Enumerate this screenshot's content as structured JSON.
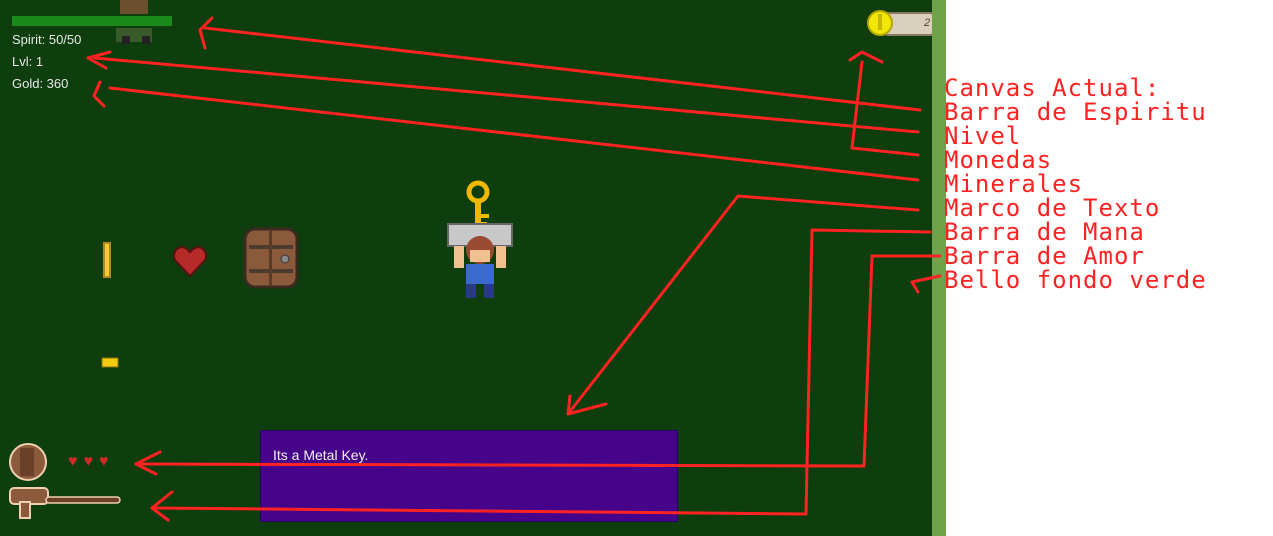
{
  "hud": {
    "spirit": "Spirit: 50/50",
    "level": "Lvl: 1",
    "gold": "Gold: 360",
    "spirit_fill": 1.0
  },
  "coins": {
    "count": "2"
  },
  "dialog": {
    "text": "Its a Metal Key."
  },
  "hearts": {
    "count": 3,
    "glyph": "♥♥♥"
  },
  "annotations": {
    "lines": [
      "Canvas Actual:",
      "Barra de Espiritu",
      "Nivel",
      "Monedas",
      "Minerales",
      "Marco de Texto",
      "Barra de Mana",
      "Barra de Amor",
      "Bello fondo verde"
    ]
  },
  "colors": {
    "background": "#0e3d0e",
    "spirit_bar": "#1a8a1a",
    "dialog_bg": "#45048a",
    "annotation": "#ff2222"
  },
  "icons": [
    "spirit-orb-icon",
    "coin-icon",
    "key-icon",
    "heart-icon",
    "door-icon",
    "player-sprite",
    "crystal-icon",
    "gold-nugget-icon",
    "love-bar-icon",
    "mana-bar-icon"
  ]
}
